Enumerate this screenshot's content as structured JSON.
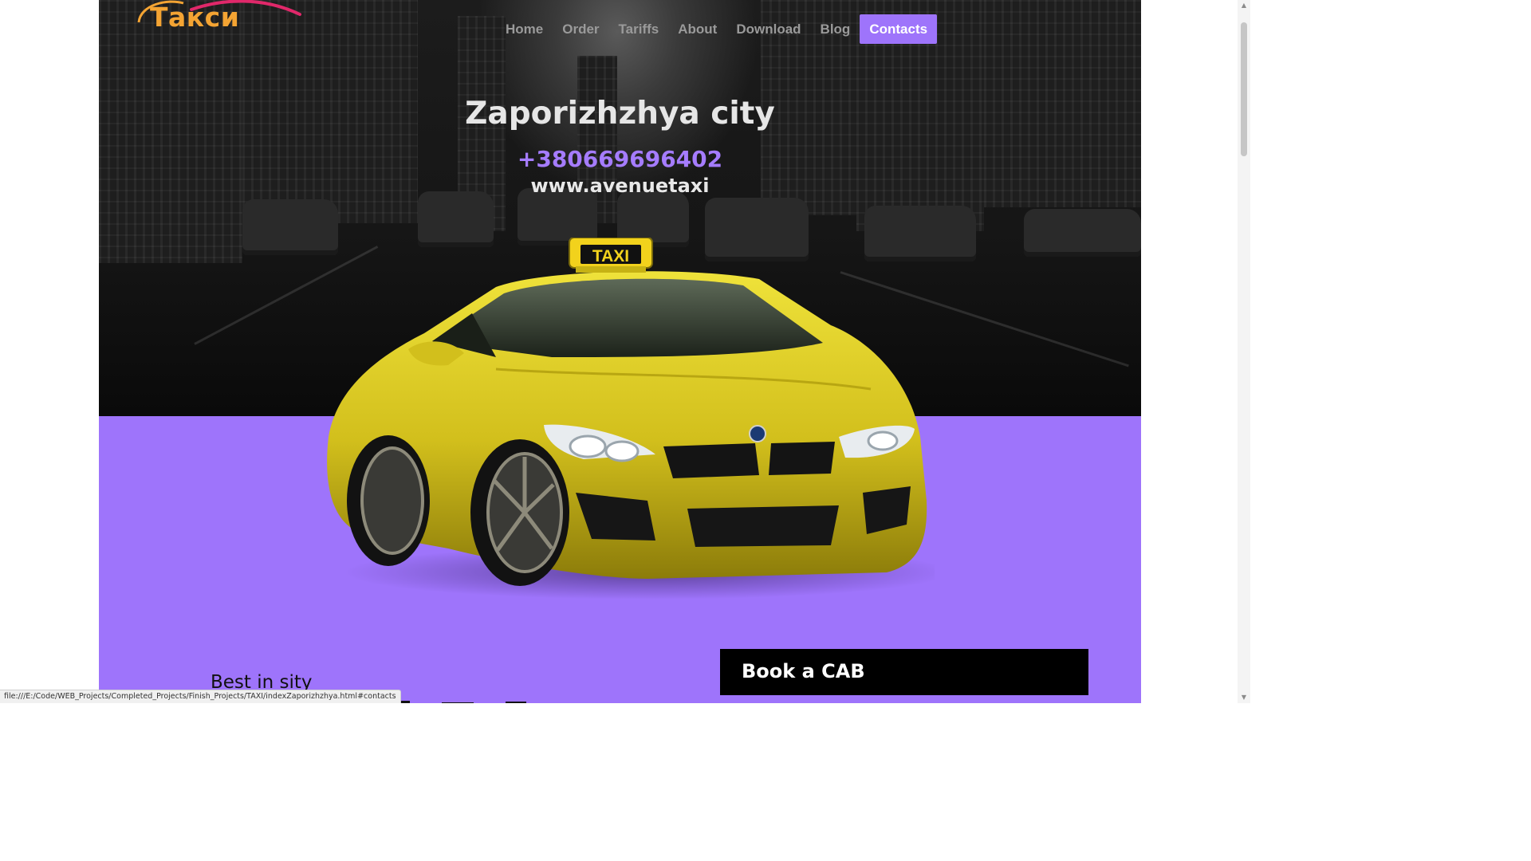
{
  "logo": {
    "text": "Такси"
  },
  "nav": {
    "items": [
      {
        "label": "Home",
        "active": false
      },
      {
        "label": "Order",
        "active": false
      },
      {
        "label": "Tariffs",
        "active": false
      },
      {
        "label": "About",
        "active": false
      },
      {
        "label": "Download",
        "active": false
      },
      {
        "label": "Blog",
        "active": false
      },
      {
        "label": "Contacts",
        "active": true
      }
    ]
  },
  "hero": {
    "title": "Zaporizhzhya city",
    "phone": "+380669696402",
    "website": "www.avenuetaxi"
  },
  "car": {
    "roof_sign": "TAXI",
    "color": "#d9c61e"
  },
  "content": {
    "best_heading": "Best in sity",
    "book_label": "Book a CAB"
  },
  "status_bar": {
    "url": "file:///E:/Code/WEB_Projects/Completed_Projects/Finish_Projects/TAXI/indexZaporizhzhya.html#contacts"
  },
  "colors": {
    "accent_purple": "#9e74fb",
    "phone_purple": "#a57cff",
    "logo_orange": "#f4a433",
    "hero_dark": "#161616"
  }
}
